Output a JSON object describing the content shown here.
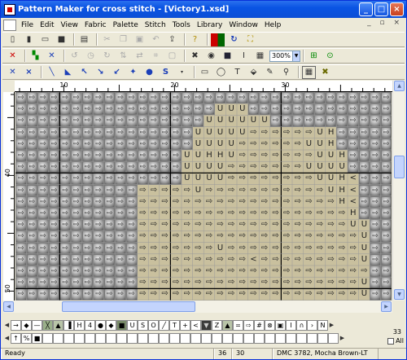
{
  "window": {
    "title": "Pattern Maker for cross stitch - [Victory1.xsd]"
  },
  "menu": [
    "File",
    "Edit",
    "View",
    "Fabric",
    "Palette",
    "Stitch",
    "Tools",
    "Library",
    "Window",
    "Help"
  ],
  "toolbar": {
    "zoom_value": "300%"
  },
  "rulers": {
    "top_labels": [
      "10",
      "20",
      "30"
    ],
    "left_labels": [
      "40",
      "50"
    ]
  },
  "pattern": {
    "rows": [
      "SSSSSSSSSSSSSSSSSSSSSSSSSSSSSSSSSS",
      "SSSSSSSSSSSSSSSSSSUUUSSSSSSSSSSSSS",
      "SSSSSSSSSSSSSSSSSUUUUUUSSSSSSSSSSS",
      "SSSSSSSSSSSSSSSSUUUUU>>>>>>UHSSSSS",
      "SSSSSSSSSSSSSSSSUUUU>>>>>>UUHSSSSS",
      "SSSSSSSSSSSSSSSUUHHU>>>>>>>UUHSSSS",
      "SSSSSSSSSSSSSSSUUUU>>>>>>>UUUUSSSS",
      "SSSSSSSSSSSSSSSUUUU>>>>>>>>UUH<SSS",
      "SSSSSSSSSSS>>>>>U>>>>>>>>>>>UH<SSS",
      "SSSSSSSSSSS>>>>>>>>>>>>>>>>>>H<SSS",
      "SSSSSSSSSSS>>>>>>>>>>>>>>>>>>>HSSS",
      "SSSSSSSSSSS>>>>>>>>>>>>>>>>>>>UUSS",
      "SSSSSSSSSSS>>>>>>>>>>>>>>>>>>>>USS",
      "SSSSSSSSSSS>>>>>>>U>>>>>>>>>>>>USS",
      "SSSSSSSSSSS>>>>>>>>>><>>>>>>>>>USS",
      "SSSSSSSSSSS>>>>>>>>>>>>>>>>>>>>>SS",
      "SSSSSSSSSSS>>>>>>>>>>>>>>>>>>>>USS",
      "SSSSSSSSSSS>>>>>>>>>>>>>>>>>>>>USS"
    ],
    "symbols": {
      "S": "⇨",
      ">": "⇨",
      "U": "U",
      "H": "H",
      "<": "<"
    }
  },
  "palette": {
    "row1": [
      "→",
      "◆",
      "—",
      "╳",
      "▲",
      "▐",
      "H",
      "4",
      "●",
      "◆",
      "■",
      "U",
      "S",
      "O",
      "╱",
      "T",
      "+",
      "<",
      "▼",
      "Z",
      "▲",
      "=",
      "⇨",
      "#",
      "⊗",
      "▣",
      "I",
      "∩",
      "›",
      "N"
    ],
    "row2": [
      "↑",
      "%",
      "■"
    ],
    "count": "33",
    "all_label": "All"
  },
  "status": {
    "left": "Ready",
    "x": "36",
    "y": "30",
    "thread": "DMC  3782, Mocha Brown-LT"
  }
}
